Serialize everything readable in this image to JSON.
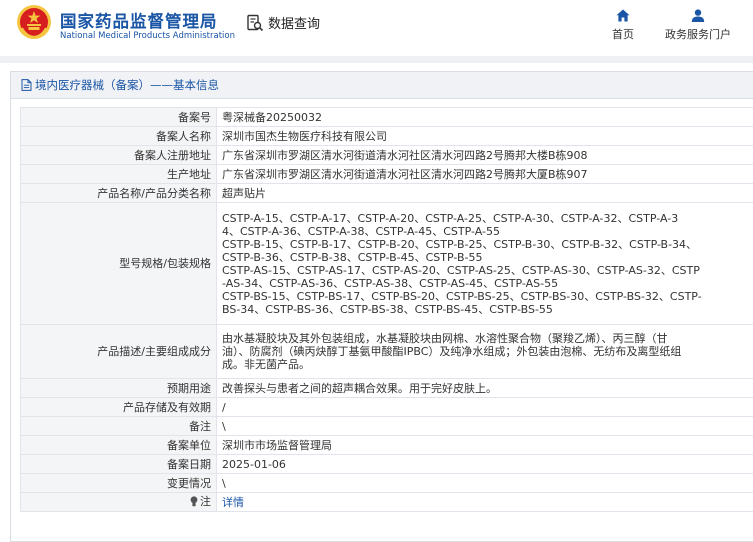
{
  "header": {
    "brand_cn": "国家药品监督管理局",
    "brand_en": "National Medical Products Administration",
    "query_label": "数据查询",
    "nav": {
      "home": "首页",
      "portal": "政务服务门户"
    },
    "colors": {
      "brand": "#1a55a6",
      "emblem_red": "#d71e1e",
      "emblem_gold": "#f5c542"
    }
  },
  "panel": {
    "title": "境内医疗器械（备案）——基本信息"
  },
  "rows": {
    "filing_no": {
      "label": "备案号",
      "value": "粤深械备20250032"
    },
    "filer_name": {
      "label": "备案人名称",
      "value": "深圳市国杰生物医疗科技有限公司"
    },
    "filer_address": {
      "label": "备案人注册地址",
      "value": "广东省深圳市罗湖区清水河街道清水河社区清水河四路2号腾邦大楼B栋908"
    },
    "production_address": {
      "label": "生产地址",
      "value": "广东省深圳市罗湖区清水河街道清水河社区清水河四路2号腾邦大厦B栋907"
    },
    "product_name": {
      "label": "产品名称/产品分类名称",
      "value": "超声贴片"
    },
    "models": {
      "label": "型号规格/包装规格",
      "lines": [
        "CSTP-A-15、CSTP-A-17、CSTP-A-20、CSTP-A-25、CSTP-A-30、CSTP-A-32、CSTP-A-3",
        "4、CSTP-A-36、CSTP-A-38、CSTP-A-45、CSTP-A-55",
        "CSTP-B-15、CSTP-B-17、CSTP-B-20、CSTP-B-25、CSTP-B-30、CSTP-B-32、CSTP-B-34、",
        "CSTP-B-36、CSTP-B-38、CSTP-B-45、CSTP-B-55",
        "CSTP-AS-15、CSTP-AS-17、CSTP-AS-20、CSTP-AS-25、CSTP-AS-30、CSTP-AS-32、CSTP",
        "-AS-34、CSTP-AS-36、CSTP-AS-38、CSTP-AS-45、CSTP-AS-55",
        "CSTP-BS-15、CSTP-BS-17、CSTP-BS-20、CSTP-BS-25、CSTP-BS-30、CSTP-BS-32、CSTP-",
        "BS-34、CSTP-BS-36、CSTP-BS-38、CSTP-BS-45、CSTP-BS-55"
      ]
    },
    "description": {
      "label": "产品描述/主要组成成分",
      "lines": [
        "由水基凝胶块及其外包装组成，水基凝胶块由网棉、水溶性聚合物（聚羧乙烯）、丙三醇（甘",
        "油）、防腐剂（碘丙炔醇丁基氨甲酸酯IPBC）及纯净水组成；外包装由泡棉、无纺布及离型纸组",
        "成。非无菌产品。"
      ]
    },
    "intended_use": {
      "label": "预期用途",
      "value": "改善探头与患者之间的超声耦合效果。用于完好皮肤上。"
    },
    "storage": {
      "label": "产品存储及有效期",
      "value": "/"
    },
    "remark": {
      "label": "备注",
      "value": "\\"
    },
    "filing_unit": {
      "label": "备案单位",
      "value": "深圳市市场监督管理局"
    },
    "filing_date": {
      "label": "备案日期",
      "value": "2025-01-06"
    },
    "change": {
      "label": "变更情况",
      "value": "\\"
    },
    "note": {
      "label": "注",
      "value": "详情"
    }
  }
}
